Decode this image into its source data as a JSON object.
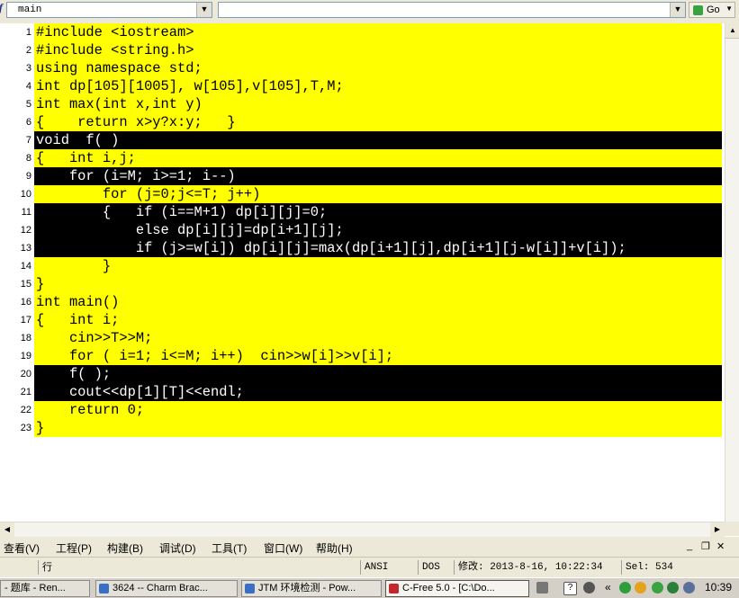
{
  "toolbar": {
    "function_combo_value": "main",
    "second_combo_value": "",
    "go_label": "Go"
  },
  "code_lines": [
    {
      "num": "1",
      "text": "#include <iostream>",
      "hl": "yellow"
    },
    {
      "num": "2",
      "text": "#include <string.h>",
      "hl": "yellow"
    },
    {
      "num": "3",
      "text": "using namespace std;",
      "hl": "yellow"
    },
    {
      "num": "4",
      "text": "int dp[105][1005], w[105],v[105],T,M;",
      "hl": "yellow"
    },
    {
      "num": "5",
      "text": "int max(int x,int y)",
      "hl": "yellow"
    },
    {
      "num": "6",
      "text": "{    return x>y?x:y;   }",
      "hl": "yellow"
    },
    {
      "num": "7",
      "text": "void  f( )",
      "hl": "black"
    },
    {
      "num": "8",
      "text": "{   int i,j;",
      "hl": "yellow"
    },
    {
      "num": "9",
      "text": "    for (i=M; i>=1; i--)",
      "hl": "black"
    },
    {
      "num": "10",
      "text": "        for (j=0;j<=T; j++)",
      "hl": "yellow"
    },
    {
      "num": "11",
      "text": "        {   if (i==M+1) dp[i][j]=0;",
      "hl": "black"
    },
    {
      "num": "12",
      "text": "            else dp[i][j]=dp[i+1][j];",
      "hl": "black"
    },
    {
      "num": "13",
      "text": "            if (j>=w[i]) dp[i][j]=max(dp[i+1][j],dp[i+1][j-w[i]]+v[i]);",
      "hl": "black"
    },
    {
      "num": "14",
      "text": "        }",
      "hl": "yellow"
    },
    {
      "num": "15",
      "text": "}",
      "hl": "yellow"
    },
    {
      "num": "16",
      "text": "int main()",
      "hl": "yellow"
    },
    {
      "num": "17",
      "text": "{   int i;",
      "hl": "yellow"
    },
    {
      "num": "18",
      "text": "    cin>>T>>M;",
      "hl": "yellow"
    },
    {
      "num": "19",
      "text": "    for ( i=1; i<=M; i++)  cin>>w[i]>>v[i];",
      "hl": "yellow"
    },
    {
      "num": "20",
      "text": "    f( );",
      "hl": "black"
    },
    {
      "num": "21",
      "text": "    cout<<dp[1][T]<<endl;",
      "hl": "black"
    },
    {
      "num": "22",
      "text": "    return 0;",
      "hl": "yellow"
    },
    {
      "num": "23",
      "text": "}",
      "hl": "yellow"
    }
  ],
  "menu": {
    "view": "查看(V)",
    "project": "工程(P)",
    "build": "构建(B)",
    "debug": "调试(D)",
    "tools": "工具(T)",
    "window": "窗口(W)",
    "help": "帮助(H)"
  },
  "status": {
    "line_label": "行",
    "encoding": "ANSI",
    "line_ending": "DOS",
    "modified": "修改: 2013-8-16, 10:22:34",
    "selection": "Sel: 534"
  },
  "taskbar": {
    "tasks": [
      {
        "label": "- 题库 - Ren..."
      },
      {
        "label": "3624 -- Charm Brac..."
      },
      {
        "label": "JTM 环境检测 - Pow..."
      },
      {
        "label": "C-Free 5.0 - [C:\\Do..."
      }
    ],
    "clock": "10:39"
  },
  "colors": {
    "highlight_yellow": "#ffff00",
    "highlight_black": "#000000",
    "chrome": "#ece9d8"
  }
}
